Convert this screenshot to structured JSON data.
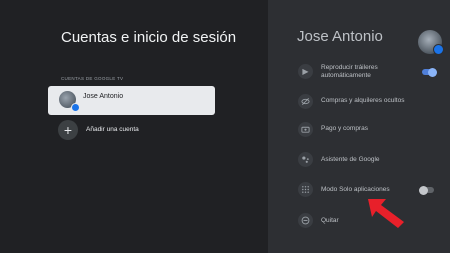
{
  "left": {
    "title": "Cuentas e inicio de sesión",
    "section_label": "CUENTAS DE GOOGLE TV",
    "account_name": "Jose Antonio",
    "add_account_label": "Añadir una cuenta"
  },
  "right": {
    "profile_name": "Jose Antonio",
    "items": [
      {
        "label": "Reproducir tráileres automáticamente",
        "icon": "play-circle-icon",
        "toggle": "on"
      },
      {
        "label": "Compras y alquileres ocultos",
        "icon": "eye-off-icon"
      },
      {
        "label": "Pago y compras",
        "icon": "payment-icon"
      },
      {
        "label": "Asistente de Google",
        "icon": "google-assistant-icon"
      },
      {
        "label": "Modo Solo aplicaciones",
        "icon": "apps-grid-icon",
        "toggle": "off"
      },
      {
        "label": "Quitar",
        "icon": "remove-circle-icon"
      }
    ]
  },
  "colors": {
    "background_left": "#202124",
    "background_right": "#2d2f33",
    "card": "#e8eaed",
    "toggle_on": "#8ab4f8",
    "annotation_arrow": "#e8202a"
  }
}
